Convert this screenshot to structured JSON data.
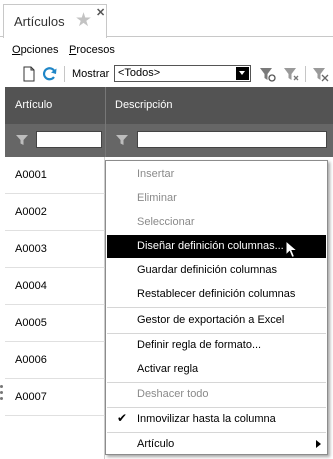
{
  "tab": {
    "title": "Artículos"
  },
  "menu": {
    "opciones": "Opciones",
    "procesos": "Procesos"
  },
  "toolbar": {
    "mostrar_label": "Mostrar",
    "mostrar_value": "<Todos>"
  },
  "grid": {
    "columns": [
      "Artículo",
      "Descripción"
    ],
    "rows": [
      "A0001",
      "A0002",
      "A0003",
      "A0004",
      "A0005",
      "A0006",
      "A0007"
    ]
  },
  "context_menu": {
    "items": [
      {
        "label": "Insertar",
        "enabled": false
      },
      {
        "label": "Eliminar",
        "enabled": false
      },
      {
        "label": "Seleccionar",
        "enabled": false
      },
      {
        "label": "Diseñar definición columnas...",
        "enabled": true,
        "highlighted": true
      },
      {
        "label": "Guardar definición columnas",
        "enabled": true
      },
      {
        "label": "Restablecer definición columnas",
        "enabled": true
      },
      {
        "label": "Gestor de exportación a Excel",
        "enabled": true
      },
      {
        "label": "Definir regla de formato...",
        "enabled": true
      },
      {
        "label": "Activar regla",
        "enabled": true
      },
      {
        "label": "Deshacer todo",
        "enabled": false
      },
      {
        "label": "Inmovilizar hasta la columna",
        "enabled": true,
        "checked": true
      },
      {
        "label": "Artículo",
        "enabled": true,
        "submenu": true
      }
    ]
  },
  "colors": {
    "header_bg": "#535353",
    "filter_bg": "#666666",
    "highlight_bg": "#000000",
    "disabled_text": "#8a8a8a"
  }
}
